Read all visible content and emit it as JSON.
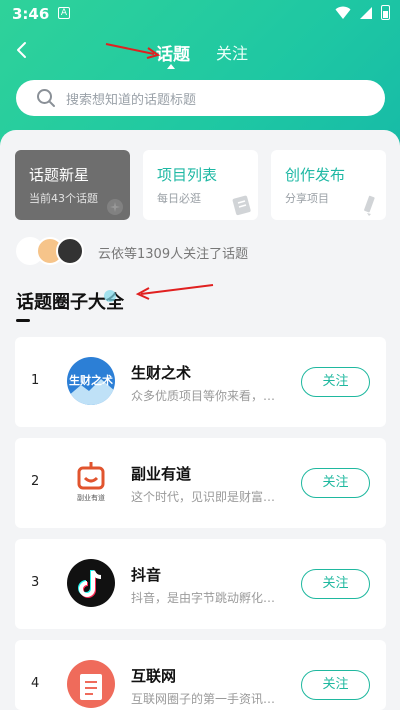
{
  "status_bar": {
    "time": "3:46",
    "a_label": "A"
  },
  "nav": {
    "tab_topics": "话题",
    "tab_follow": "关注"
  },
  "search": {
    "placeholder": "搜索想知道的话题标题"
  },
  "quick_cards": [
    {
      "title": "话题新星",
      "subtitle": "当前43个话题"
    },
    {
      "title": "项目列表",
      "subtitle": "每日必逛"
    },
    {
      "title": "创作发布",
      "subtitle": "分享项目"
    }
  ],
  "followers": {
    "text": "云依等1309人关注了话题"
  },
  "section": {
    "title": "话题圈子大全"
  },
  "topics": [
    {
      "rank": "1",
      "name": "生财之术",
      "desc": "众多优质项目等你来看，…",
      "logo_text": "生财之术",
      "button": "关注"
    },
    {
      "rank": "2",
      "name": "副业有道",
      "desc": "这个时代，见识即是财富…",
      "logo_text": "副业有道",
      "button": "关注"
    },
    {
      "rank": "3",
      "name": "抖音",
      "desc": "抖音，是由字节跳动孵化…",
      "button": "关注"
    },
    {
      "rank": "4",
      "name": "互联网",
      "desc": "互联网圈子的第一手资讯…",
      "button": "关注"
    }
  ],
  "colors": {
    "accent": "#1fb89f",
    "header_gradient_start": "#2fd29a",
    "header_gradient_end": "#16b9a8",
    "annotation_arrow": "#e02020"
  }
}
